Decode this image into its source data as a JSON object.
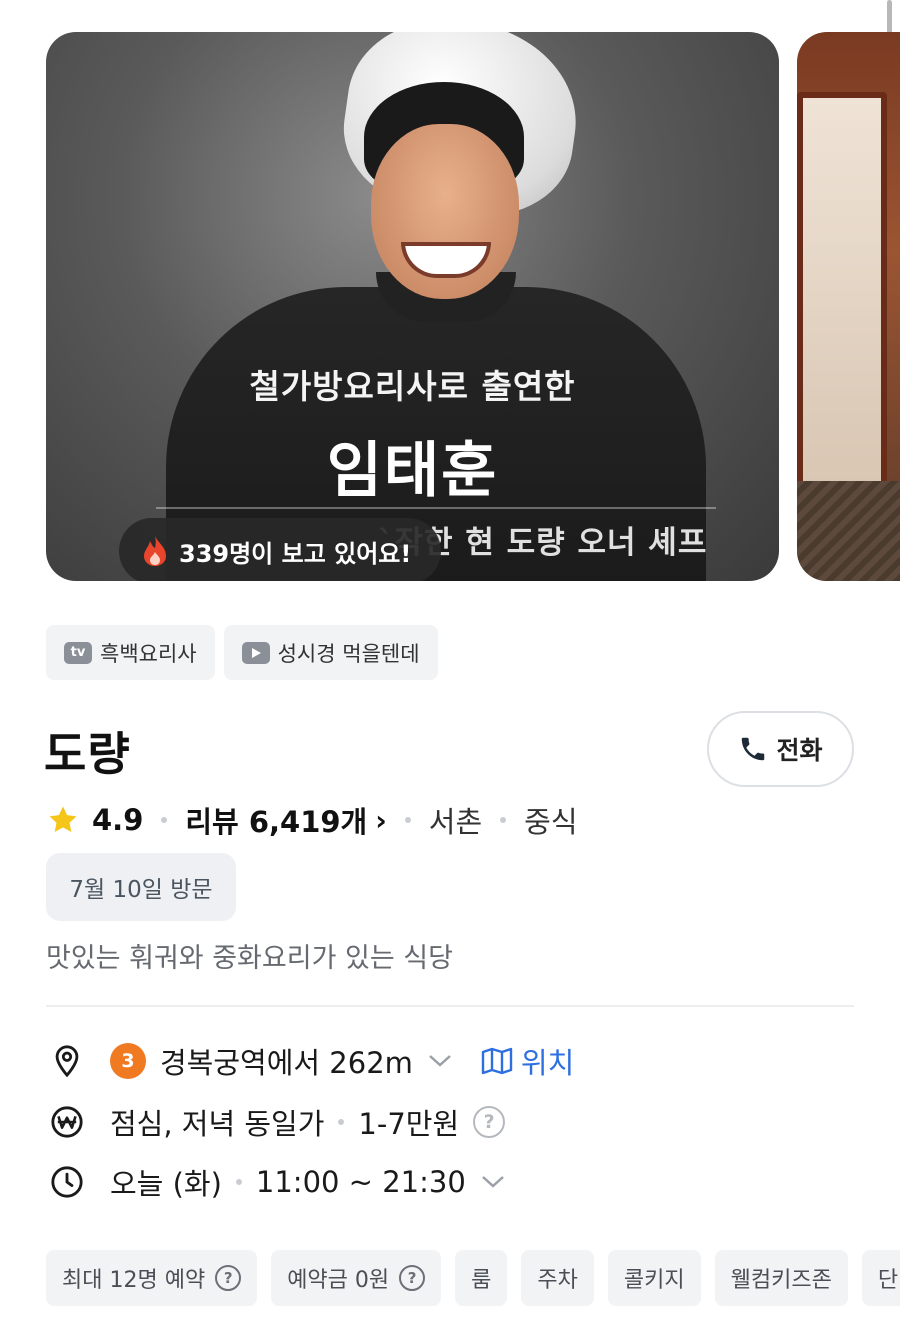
{
  "carousel": {
    "caption_line1": "철가방요리사로 출연한",
    "caption_line2": "임태훈",
    "caption_line3": "`작한 현 도량 오너 셰프",
    "viewers_text": "339명이 보고 있어요!"
  },
  "tags": [
    {
      "icon": "tv-icon",
      "icon_text": "tv",
      "label": "흑백요리사"
    },
    {
      "icon": "play-icon",
      "label": "성시경 먹을텐데"
    }
  ],
  "restaurant": {
    "name": "도량",
    "call_label": "전화",
    "rating": "4.9",
    "reviews": "리뷰 6,419개",
    "area": "서촌",
    "category": "중식",
    "visit_badge": "7월 10일 방문",
    "description": "맛있는 훠궈와 중화요리가 있는 식당"
  },
  "info": {
    "line_number": "3",
    "distance": "경복궁역에서 262m",
    "map_label": "위치",
    "meal": "점심, 저녁 동일가",
    "price": "1-7만원",
    "day": "오늘 (화)",
    "hours": "11:00 ~ 21:30"
  },
  "chips": [
    {
      "label": "최대 12명 예약",
      "help": true
    },
    {
      "label": "예약금 0원",
      "help": true
    },
    {
      "label": "룸",
      "help": false
    },
    {
      "label": "주차",
      "help": false
    },
    {
      "label": "콜키지",
      "help": false
    },
    {
      "label": "웰컴키즈존",
      "help": false
    },
    {
      "label": "단",
      "help": false
    }
  ],
  "colors": {
    "accent_blue": "#2d6fe0",
    "subway_line3": "#f07a22",
    "star": "#f5c518",
    "flame": "#e8452c"
  }
}
